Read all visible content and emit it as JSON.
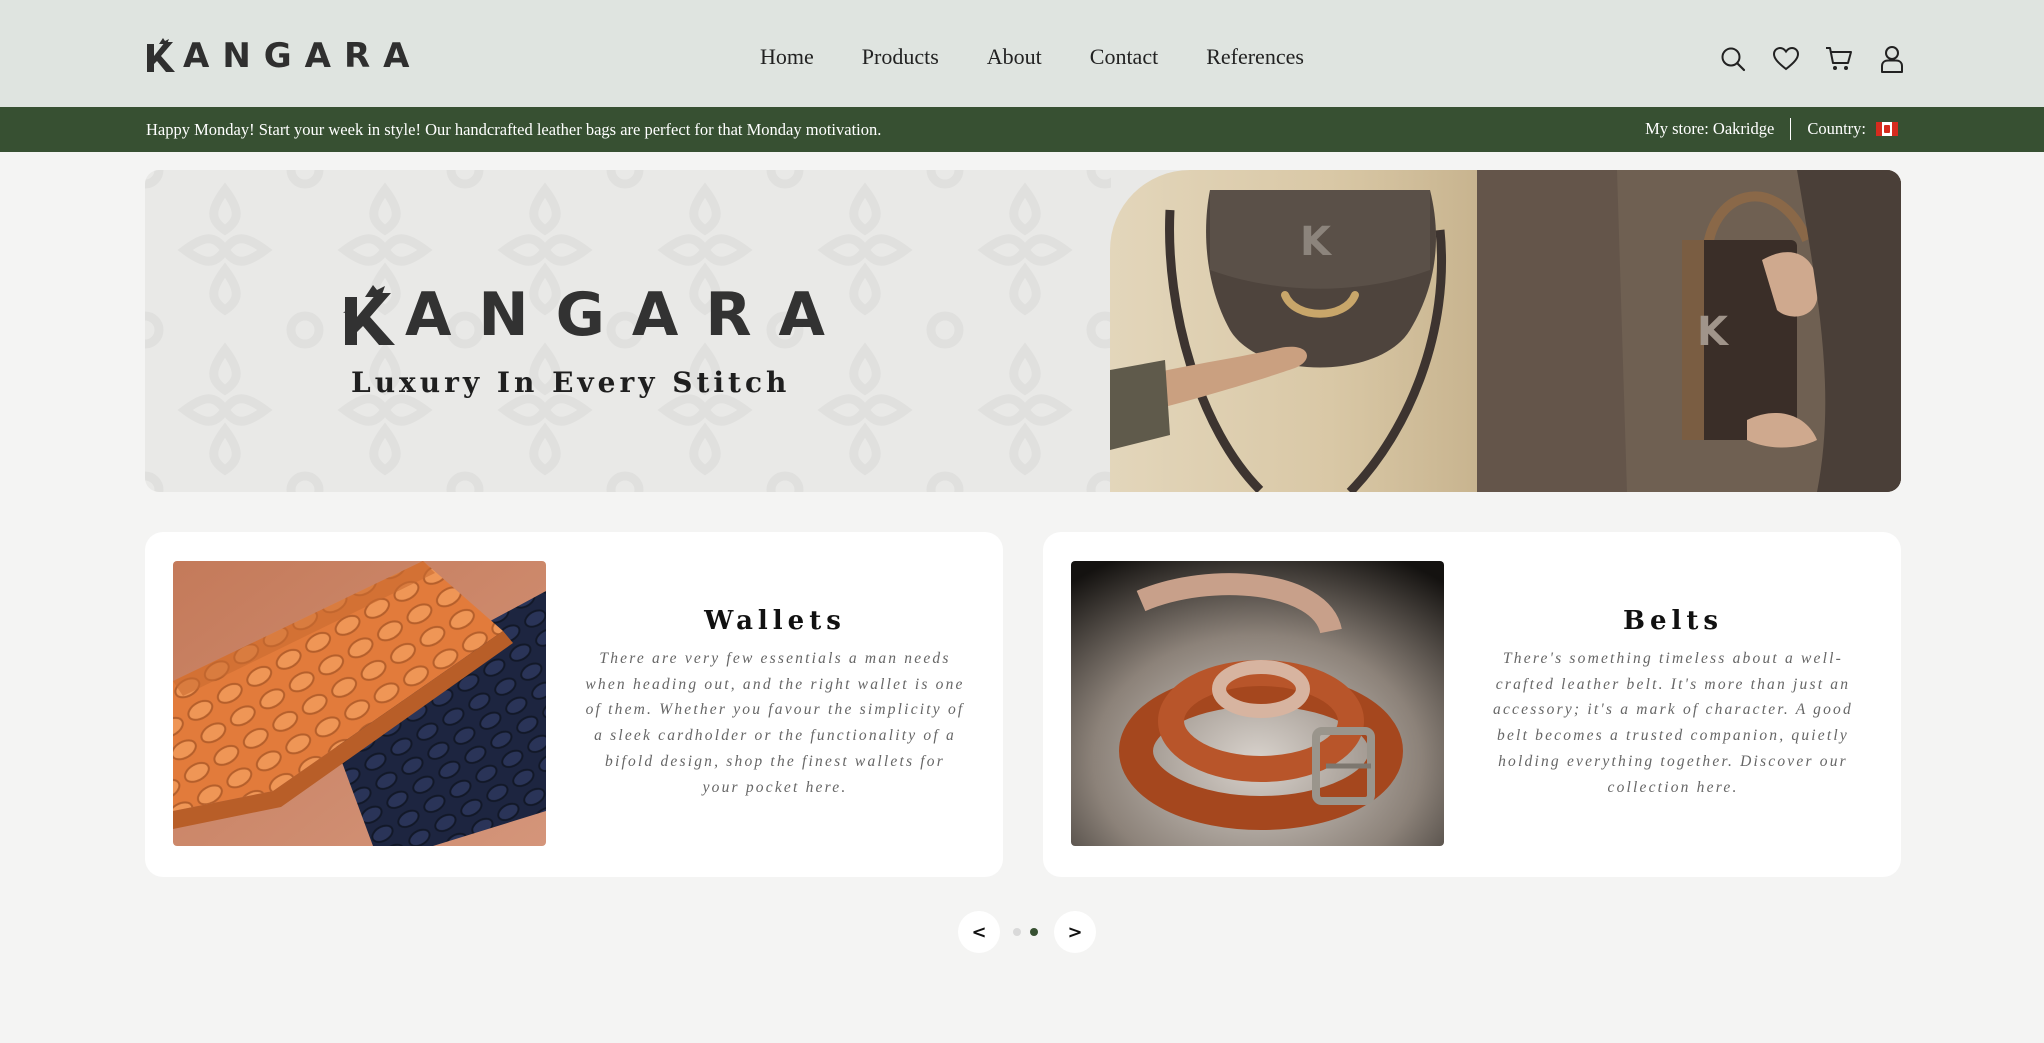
{
  "header": {
    "logo_text": "ANGARA",
    "nav": [
      {
        "label": "Home"
      },
      {
        "label": "Products"
      },
      {
        "label": "About"
      },
      {
        "label": "Contact"
      },
      {
        "label": "References"
      }
    ],
    "icons": [
      "search-icon",
      "heart-icon",
      "cart-icon",
      "user-icon"
    ]
  },
  "announcement": {
    "message": "Happy Monday! Start your week in style! Our handcrafted leather bags are perfect for that Monday motivation.",
    "store": "My store: Oakridge",
    "country_label": "Country:",
    "country_flag": "canada-flag-icon"
  },
  "hero": {
    "logo_text": "ANGARA",
    "tagline": "Luxury In Every Stitch"
  },
  "cards": [
    {
      "title": "Wallets",
      "text": "There are very few essentials a man needs when heading out, and the right wallet is one of them. Whether you favour the simplicity of a sleek cardholder or the functionality of a bifold design, shop the finest wallets for your pocket here."
    },
    {
      "title": "Belts",
      "text": "There's something timeless about a well-crafted leather belt. It's more than just an accessory; it's a mark of character. A good belt becomes a trusted companion, quietly holding everything together. Discover our collection here."
    }
  ],
  "carousel": {
    "prev_label": "<",
    "next_label": ">",
    "dots": 2,
    "active_dot": 2
  },
  "colors": {
    "header_bg": "#dfe4e0",
    "announce_bg": "#375032",
    "page_bg": "#f4f4f3",
    "accent_green": "#375032"
  }
}
